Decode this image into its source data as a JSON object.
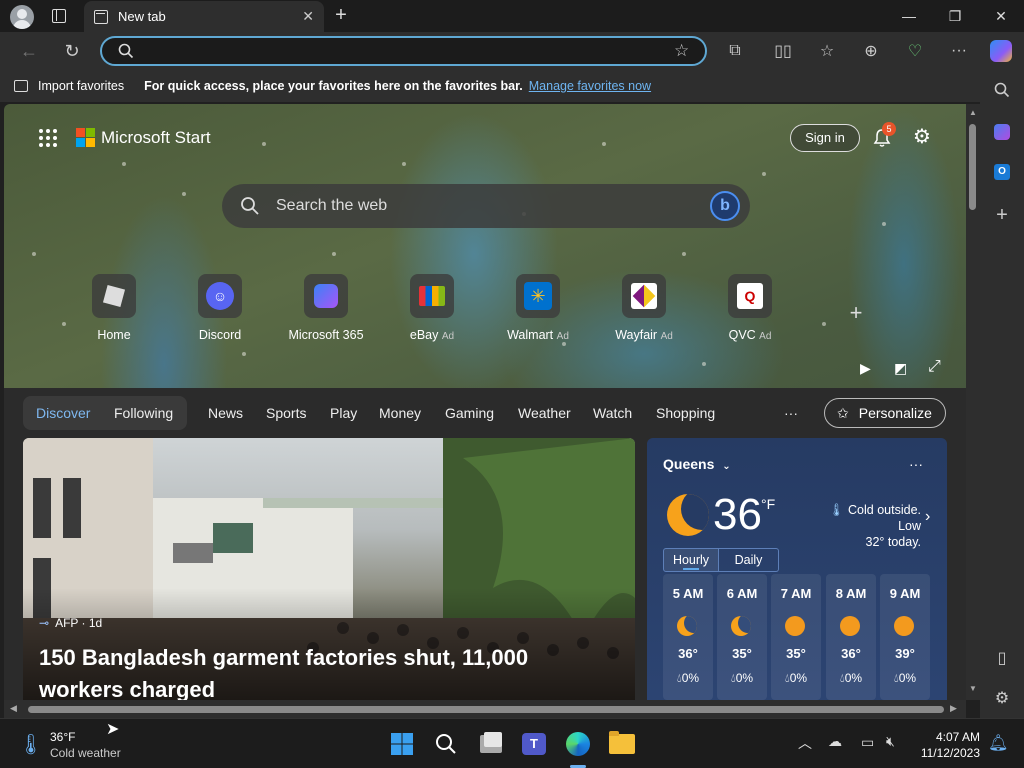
{
  "browser": {
    "tab_title": "New tab",
    "address_value": "",
    "favbar": {
      "import_label": "Import favorites",
      "hint": "For quick access, place your favorites here on the favorites bar.",
      "manage_link": "Manage favorites now"
    }
  },
  "header": {
    "brand": "Microsoft Start",
    "sign_in": "Sign in",
    "notif_count": "5"
  },
  "search": {
    "placeholder": "Search the web"
  },
  "quicklinks": [
    {
      "label": "Home",
      "ad": ""
    },
    {
      "label": "Discord",
      "ad": ""
    },
    {
      "label": "Microsoft 365",
      "ad": ""
    },
    {
      "label": "eBay",
      "ad": "Ad"
    },
    {
      "label": "Walmart",
      "ad": "Ad"
    },
    {
      "label": "Wayfair",
      "ad": "Ad"
    },
    {
      "label": "QVC",
      "ad": "Ad"
    }
  ],
  "feednav": {
    "discover": "Discover",
    "following": "Following",
    "items": [
      "News",
      "Sports",
      "Play",
      "Money",
      "Gaming",
      "Weather",
      "Watch",
      "Shopping"
    ],
    "more": "···",
    "personalize": "Personalize"
  },
  "news": {
    "source": "AFP · 1d",
    "headline_line1": "150 Bangladesh garment factories shut, 11,000",
    "headline_line2": "workers charged"
  },
  "weather": {
    "location": "Queens",
    "temp": "36",
    "unit": "°F",
    "summary_line1": "Cold outside. Low",
    "summary_line2": "32° today.",
    "tab_hourly": "Hourly",
    "tab_daily": "Daily",
    "more": "···",
    "hours": [
      {
        "time": "5 AM",
        "temp": "36°",
        "precip": "0%",
        "icon": "moon"
      },
      {
        "time": "6 AM",
        "temp": "35°",
        "precip": "0%",
        "icon": "moon"
      },
      {
        "time": "7 AM",
        "temp": "35°",
        "precip": "0%",
        "icon": "sun"
      },
      {
        "time": "8 AM",
        "temp": "36°",
        "precip": "0%",
        "icon": "sun"
      },
      {
        "time": "9 AM",
        "temp": "39°",
        "precip": "0%",
        "icon": "sun"
      }
    ]
  },
  "taskbar": {
    "weather_temp": "36°F",
    "weather_desc": "Cold weather",
    "time": "4:07 AM",
    "date": "11/12/2023"
  },
  "colors": {
    "accent": "#5fa8d3",
    "link": "#6eb4f0",
    "notif_badge": "#e8542a",
    "weather_bg": "#263b63"
  }
}
